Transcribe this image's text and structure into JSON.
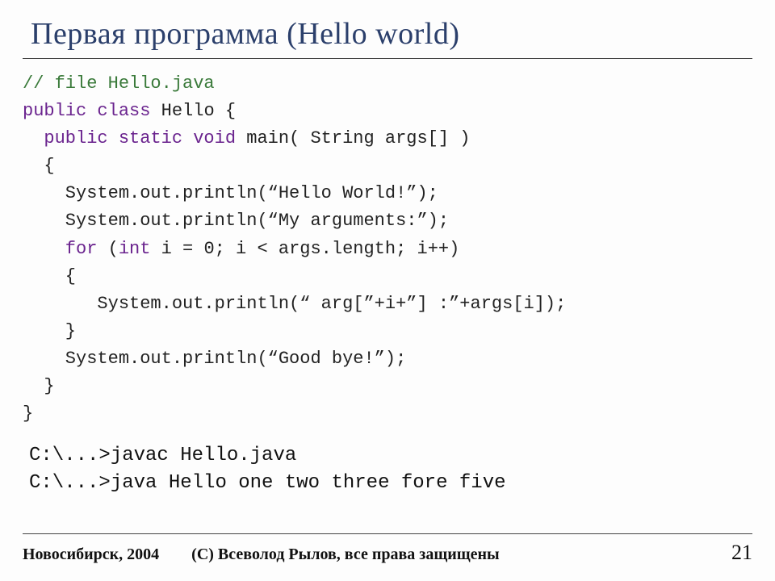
{
  "title": "Первая программа (Hello world)",
  "code": {
    "l01_comment": "// file Hello.java",
    "l02a": "public class",
    "l02b": " Hello {",
    "l03a": "  public static void",
    "l03b": " main( String args[] )",
    "l04": "  {",
    "l05": "    System.out.println(“Hello World!”);",
    "l06": "    System.out.println(“My arguments:”);",
    "l07a": "    for",
    "l07b": " (",
    "l07c": "int",
    "l07d": " i = 0; i < args.length; i++)",
    "l08": "    {",
    "l09": "       System.out.println(“ arg[”+i+”] :”+args[i]);",
    "l10": "    }",
    "l11": "    System.out.println(“Good bye!”);",
    "l12": "  }",
    "l13": "}"
  },
  "shell": {
    "line1": "C:\\...>javac Hello.java",
    "line2": "C:\\...>java Hello one two three fore five"
  },
  "footer": {
    "left": "Новосибирск, 2004",
    "center": "(С) Всеволод Рылов, все права защищены",
    "page": "21"
  }
}
